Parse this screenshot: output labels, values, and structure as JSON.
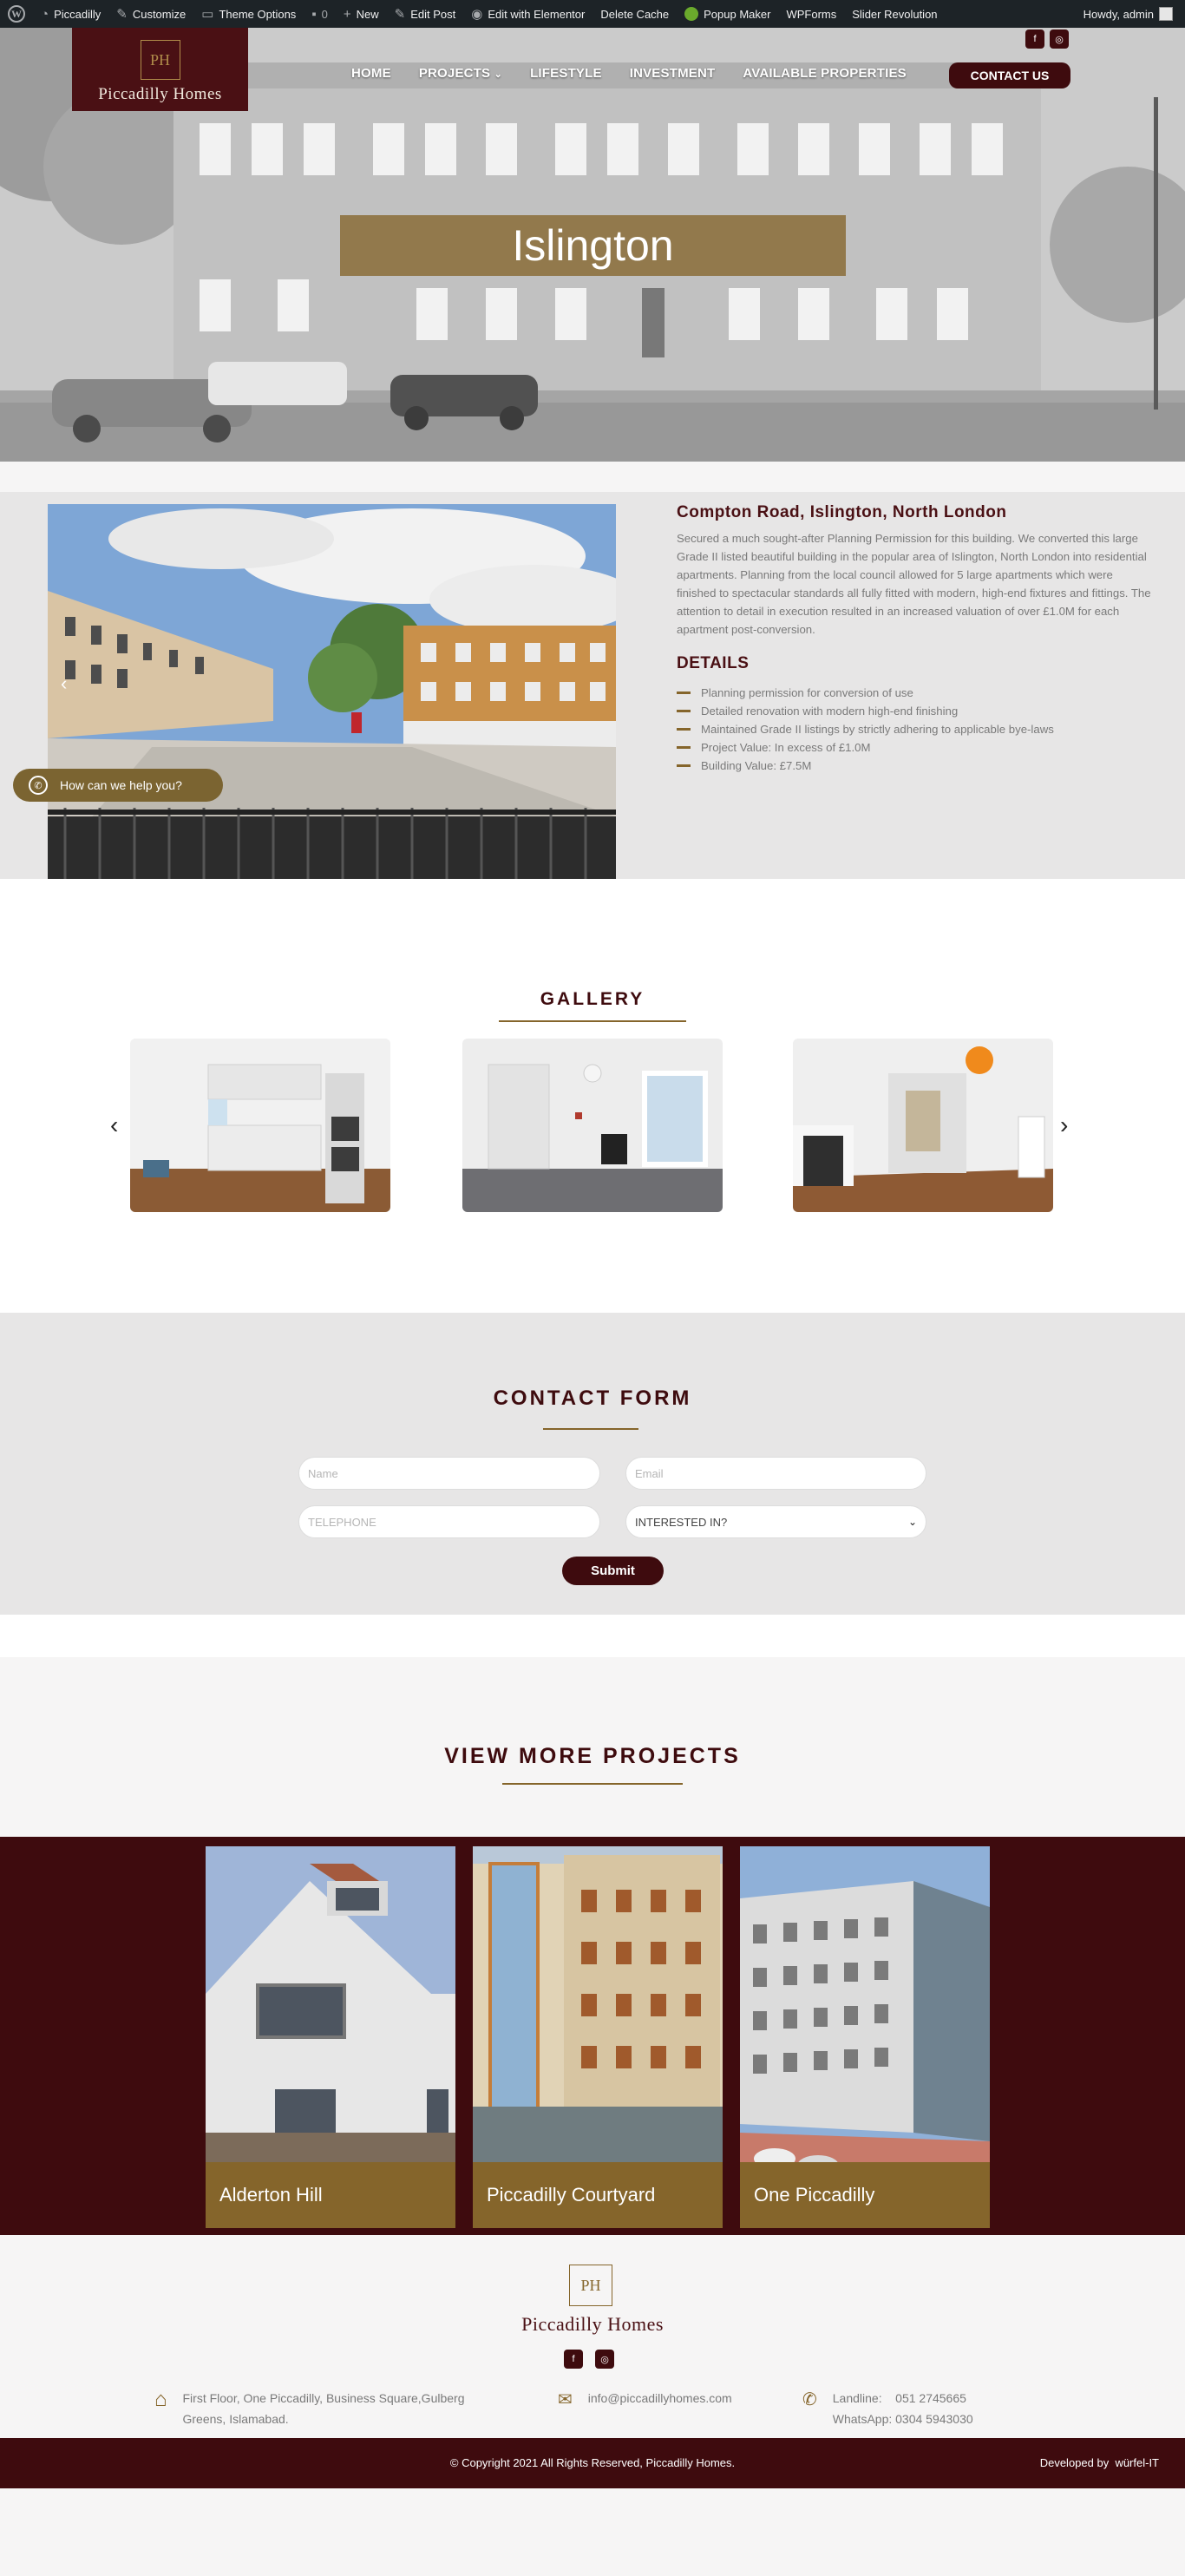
{
  "admin_bar": {
    "items": [
      "Piccadilly",
      "Customize",
      "Theme Options",
      "0",
      "New",
      "Edit Post",
      "Edit with Elementor",
      "Delete Cache",
      "Popup Maker",
      "WPForms",
      "Slider Revolution"
    ],
    "greeting": "Howdy, admin"
  },
  "header": {
    "logo_mark": "PH",
    "logo_text": "Piccadilly Homes",
    "nav": [
      "HOME",
      "PROJECTS",
      "LIFESTYLE",
      "INVESTMENT",
      "AVAILABLE PROPERTIES"
    ],
    "contact_button": "CONTACT US",
    "social": [
      "facebook-icon",
      "instagram-icon"
    ]
  },
  "hero": {
    "title": "Islington"
  },
  "project": {
    "title": "Compton Road, Islington, North London",
    "description": "Secured a much sought-after Planning Permission for this building. We converted this large Grade II listed beautiful building in the popular area of Islington, North London into residential apartments. Planning from the local council allowed for 5 large apartments which were finished to spectacular standards all fully fitted with modern, high-end fixtures and fittings. The attention to detail in execution resulted in an increased valuation of over £1.0M for each apartment post-conversion.",
    "details_heading": "DETAILS",
    "details": [
      "Planning permission for conversion of use",
      "Detailed renovation with modern high-end finishing",
      "Maintained Grade II listings by strictly adhering to applicable bye-laws",
      "Project Value: In excess of £1.0M",
      "Building Value: £7.5M"
    ]
  },
  "whatsapp": {
    "label": "How can we help you?"
  },
  "gallery": {
    "heading": "GALLERY"
  },
  "contact_form": {
    "heading": "CONTACT FORM",
    "name_placeholder": "Name",
    "email_placeholder": "Email",
    "phone_placeholder": "TELEPHONE",
    "interest_selected": "INTERESTED IN?",
    "submit": "Submit"
  },
  "more_projects": {
    "heading": "VIEW MORE PROJECTS",
    "cards": [
      "Alderton Hill",
      "Piccadilly Courtyard",
      "One Piccadilly"
    ]
  },
  "footer": {
    "logo_mark": "PH",
    "logo_text": "Piccadilly Homes",
    "address_line1": "First Floor, One Piccadilly, Business Square,Gulberg",
    "address_line2": "Greens, Islamabad.",
    "email": "info@piccadillyhomes.com",
    "landline_label": "Landline:",
    "landline": "051 2745665",
    "whatsapp": "WhatsApp: 0304 5943030",
    "copyright": "© Copyright 2021 All Rights Reserved, Piccadilly Homes.",
    "developer_label": "Developed by",
    "developer": "würfel-IT"
  },
  "colors": {
    "brand_maroon": "#3e0b0e",
    "brand_gold": "#85652b",
    "admin_bar": "#1d2327"
  }
}
